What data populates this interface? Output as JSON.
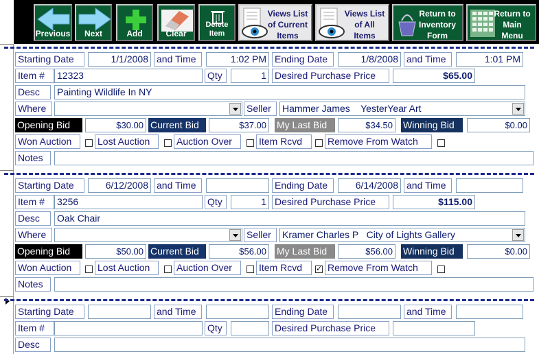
{
  "toolbar": {
    "previous": "Previous",
    "next": "Next",
    "add": "Add",
    "clear": "Clear",
    "delete": "Delete Item",
    "views_current": "Views List of Current Items",
    "views_all": "Views List of All Items",
    "return_inventory": "Return to Inventory Form",
    "return_main": "Return to Main Menu"
  },
  "labels": {
    "starting_date": "Starting Date",
    "and_time": "and Time",
    "ending_date": "Ending Date",
    "item_no": "Item #",
    "qty": "Qty",
    "desired_price": "Desired Purchase Price",
    "desc": "Desc",
    "where": "Where",
    "seller": "Seller",
    "opening_bid": "Opening Bid",
    "current_bid": "Current Bid",
    "my_last_bid": "My Last Bid",
    "winning_bid": "Winning Bid",
    "won_auction": "Won Auction",
    "lost_auction": "Lost Auction",
    "auction_over": "Auction Over",
    "item_rcvd": "Item Rcvd",
    "remove_watch": "Remove From Watch",
    "notes": "Notes"
  },
  "records": [
    {
      "start_date": "1/1/2008",
      "start_time": "1:02 PM",
      "end_date": "1/8/2008",
      "end_time": "1:01 PM",
      "item_no": "12323",
      "qty": "1",
      "desired_price": "$65.00",
      "desc": "Painting Wildlife In NY",
      "where": "",
      "seller": "Hammer James    YesterYear Art",
      "opening_bid": "$30.00",
      "current_bid": "$37.00",
      "my_last_bid": "$34.50",
      "winning_bid": "$0.00",
      "won_auction": false,
      "lost_auction": false,
      "auction_over": false,
      "item_rcvd": false,
      "remove_watch": false,
      "notes": ""
    },
    {
      "start_date": "6/12/2008",
      "start_time": "",
      "end_date": "6/14/2008",
      "end_time": "",
      "item_no": "3256",
      "qty": "1",
      "desired_price": "$115.00",
      "desc": "Oak Chair",
      "where": "",
      "seller": "Kramer Charles P   City of Lights Gallery",
      "opening_bid": "$50.00",
      "current_bid": "$56.00",
      "my_last_bid": "$56.00",
      "winning_bid": "$0.00",
      "won_auction": false,
      "lost_auction": false,
      "auction_over": false,
      "item_rcvd": true,
      "remove_watch": false,
      "notes": ""
    },
    {
      "start_date": "",
      "start_time": "",
      "end_date": "",
      "end_time": "",
      "item_no": "",
      "qty": "",
      "desired_price": "",
      "desc": ""
    }
  ],
  "colors": {
    "toolbar_bg": "#000000",
    "button_green": "#0a5a32",
    "label_text": "#1a1a7a",
    "dash": "#1c2a8c"
  },
  "icons": {
    "previous": "arrow-left-icon",
    "next": "arrow-right-icon",
    "add": "plus-icon",
    "clear": "eraser-icon",
    "delete": "trash-icon",
    "views": "eye-document-icon",
    "return_inventory": "purse-icon",
    "return_main": "grid-menu-icon"
  }
}
